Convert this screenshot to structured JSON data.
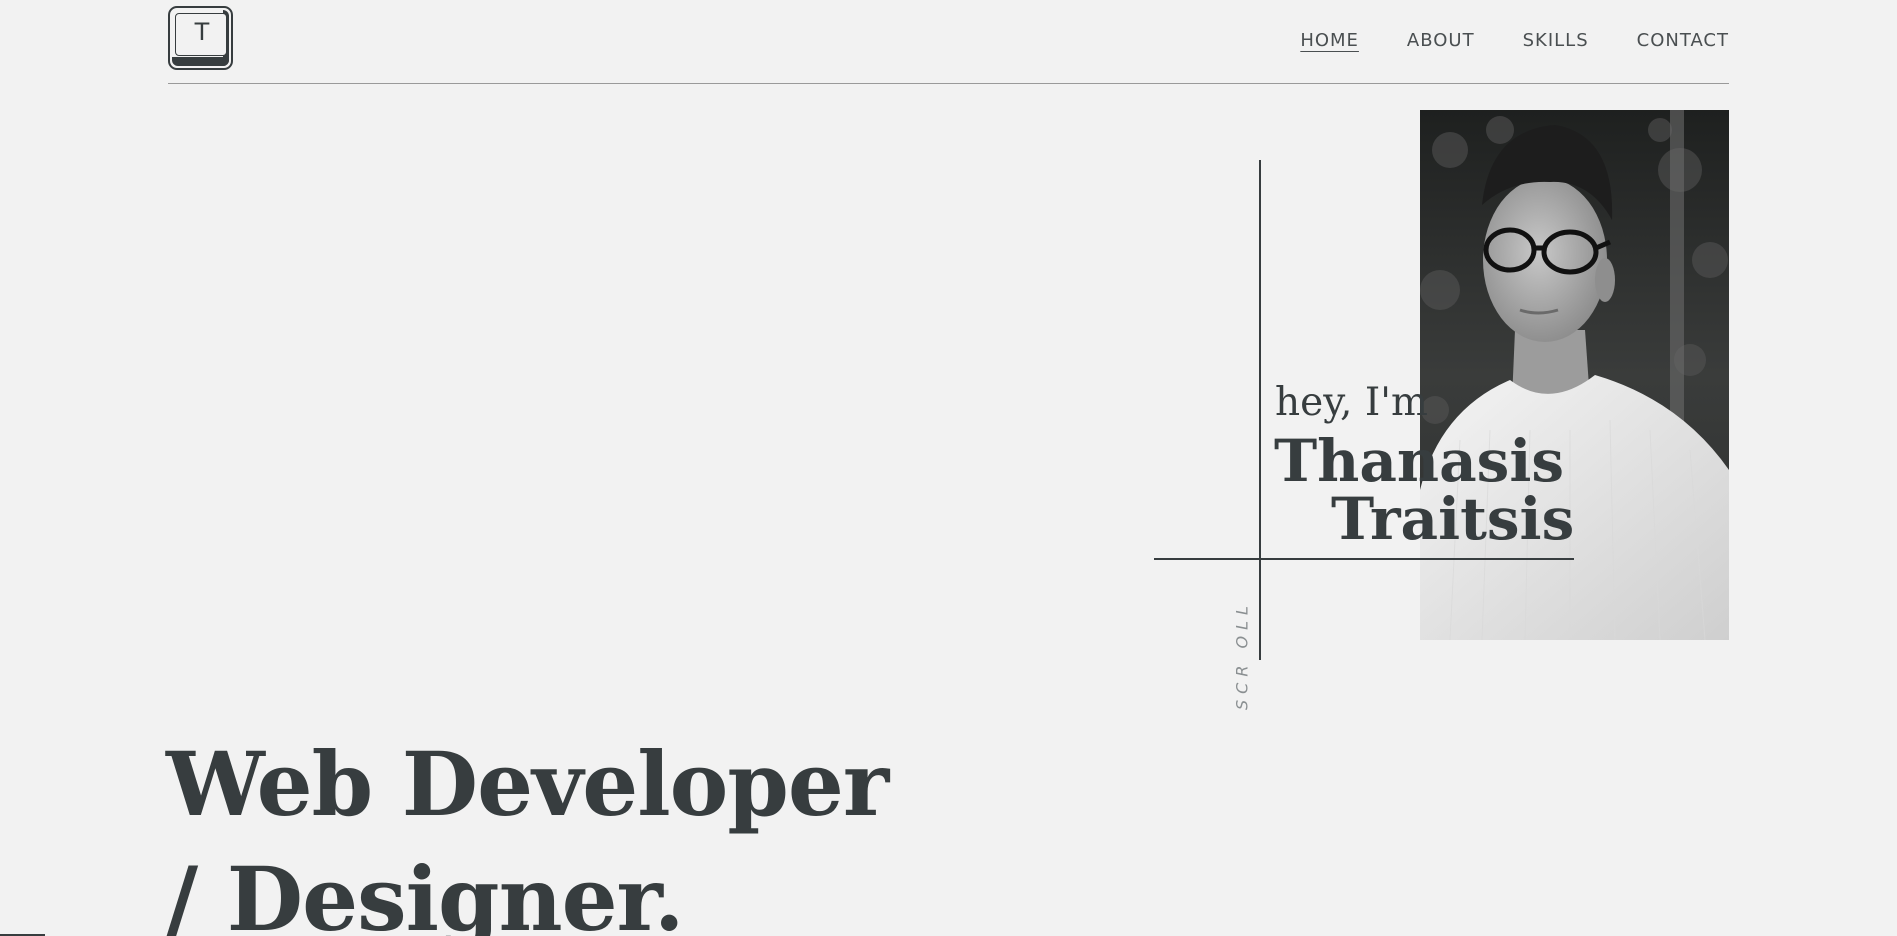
{
  "logo": {
    "letter": "T",
    "icon": "keyboard-key-logo-icon"
  },
  "nav": {
    "items": [
      {
        "label": "HOME",
        "active": true
      },
      {
        "label": "ABOUT",
        "active": false
      },
      {
        "label": "SKILLS",
        "active": false
      },
      {
        "label": "CONTACT",
        "active": false
      }
    ]
  },
  "hero": {
    "greeting": "hey, I'm",
    "first_name": "Thanasis",
    "last_name": "Traitsis",
    "scroll_label": "SCR OLL",
    "title_line1": "Web Developer",
    "title_line2": "/ Designer."
  },
  "colors": {
    "background": "#f2f2f2",
    "text": "#373d3f",
    "muted": "#8a8f91"
  }
}
